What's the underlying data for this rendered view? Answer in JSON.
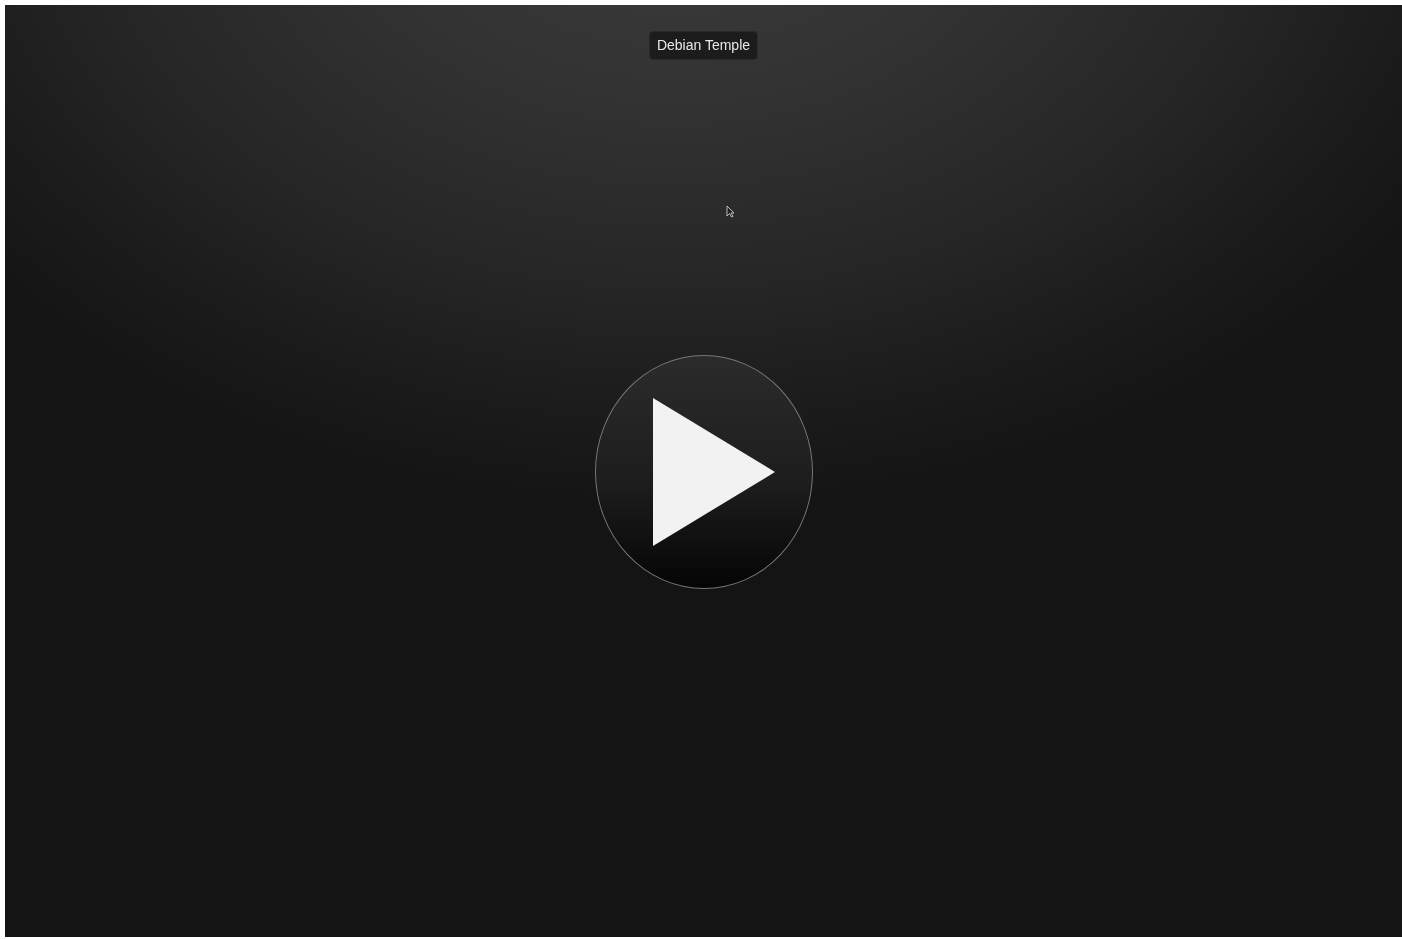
{
  "name_tooltip": {
    "text": "Debian Temple"
  }
}
